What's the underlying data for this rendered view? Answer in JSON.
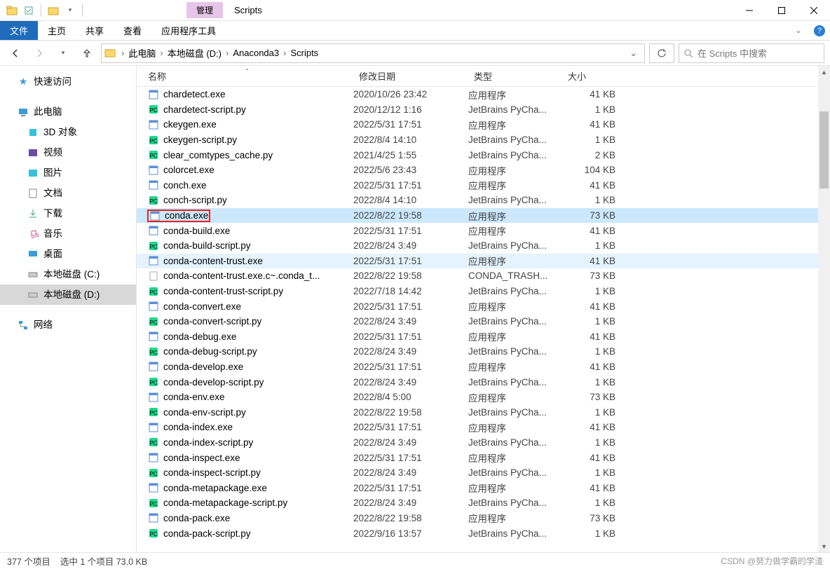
{
  "title": "Scripts",
  "context_tab": "管理",
  "ribbon": {
    "file": "文件",
    "tabs": [
      "主页",
      "共享",
      "查看",
      "应用程序工具"
    ]
  },
  "breadcrumb": [
    "此电脑",
    "本地磁盘 (D:)",
    "Anaconda3",
    "Scripts"
  ],
  "search_placeholder": "在 Scripts 中搜索",
  "nav": {
    "quick": "快速访问",
    "thispc": "此电脑",
    "items": [
      "3D 对象",
      "视频",
      "图片",
      "文档",
      "下载",
      "音乐",
      "桌面",
      "本地磁盘 (C:)",
      "本地磁盘 (D:)"
    ],
    "network": "网络"
  },
  "columns": {
    "name": "名称",
    "date": "修改日期",
    "type": "类型",
    "size": "大小"
  },
  "type_labels": {
    "app": "应用程序",
    "pycharm": "JetBrains PyCha...",
    "trash": "CONDA_TRASH..."
  },
  "files": [
    {
      "n": "chardetect.exe",
      "d": "2020/10/26 23:42",
      "t": "app",
      "s": "41 KB",
      "i": "exe"
    },
    {
      "n": "chardetect-script.py",
      "d": "2020/12/12 1:16",
      "t": "pycharm",
      "s": "1 KB",
      "i": "py"
    },
    {
      "n": "ckeygen.exe",
      "d": "2022/5/31 17:51",
      "t": "app",
      "s": "41 KB",
      "i": "exe"
    },
    {
      "n": "ckeygen-script.py",
      "d": "2022/8/4 14:10",
      "t": "pycharm",
      "s": "1 KB",
      "i": "py"
    },
    {
      "n": "clear_comtypes_cache.py",
      "d": "2021/4/25 1:55",
      "t": "pycharm",
      "s": "2 KB",
      "i": "py"
    },
    {
      "n": "colorcet.exe",
      "d": "2022/5/6 23:43",
      "t": "app",
      "s": "104 KB",
      "i": "exe"
    },
    {
      "n": "conch.exe",
      "d": "2022/5/31 17:51",
      "t": "app",
      "s": "41 KB",
      "i": "exe"
    },
    {
      "n": "conch-script.py",
      "d": "2022/8/4 14:10",
      "t": "pycharm",
      "s": "1 KB",
      "i": "py"
    },
    {
      "n": "conda.exe",
      "d": "2022/8/22 19:58",
      "t": "app",
      "s": "73 KB",
      "i": "exe",
      "selected": true,
      "redbox": true
    },
    {
      "n": "conda-build.exe",
      "d": "2022/5/31 17:51",
      "t": "app",
      "s": "41 KB",
      "i": "exe"
    },
    {
      "n": "conda-build-script.py",
      "d": "2022/8/24 3:49",
      "t": "pycharm",
      "s": "1 KB",
      "i": "py"
    },
    {
      "n": "conda-content-trust.exe",
      "d": "2022/5/31 17:51",
      "t": "app",
      "s": "41 KB",
      "i": "exe",
      "hover": true
    },
    {
      "n": "conda-content-trust.exe.c~.conda_t...",
      "d": "2022/8/22 19:58",
      "t": "trash",
      "s": "73 KB",
      "i": "file"
    },
    {
      "n": "conda-content-trust-script.py",
      "d": "2022/7/18 14:42",
      "t": "pycharm",
      "s": "1 KB",
      "i": "py"
    },
    {
      "n": "conda-convert.exe",
      "d": "2022/5/31 17:51",
      "t": "app",
      "s": "41 KB",
      "i": "exe"
    },
    {
      "n": "conda-convert-script.py",
      "d": "2022/8/24 3:49",
      "t": "pycharm",
      "s": "1 KB",
      "i": "py"
    },
    {
      "n": "conda-debug.exe",
      "d": "2022/5/31 17:51",
      "t": "app",
      "s": "41 KB",
      "i": "exe"
    },
    {
      "n": "conda-debug-script.py",
      "d": "2022/8/24 3:49",
      "t": "pycharm",
      "s": "1 KB",
      "i": "py"
    },
    {
      "n": "conda-develop.exe",
      "d": "2022/5/31 17:51",
      "t": "app",
      "s": "41 KB",
      "i": "exe"
    },
    {
      "n": "conda-develop-script.py",
      "d": "2022/8/24 3:49",
      "t": "pycharm",
      "s": "1 KB",
      "i": "py"
    },
    {
      "n": "conda-env.exe",
      "d": "2022/8/4 5:00",
      "t": "app",
      "s": "73 KB",
      "i": "exe"
    },
    {
      "n": "conda-env-script.py",
      "d": "2022/8/22 19:58",
      "t": "pycharm",
      "s": "1 KB",
      "i": "py"
    },
    {
      "n": "conda-index.exe",
      "d": "2022/5/31 17:51",
      "t": "app",
      "s": "41 KB",
      "i": "exe"
    },
    {
      "n": "conda-index-script.py",
      "d": "2022/8/24 3:49",
      "t": "pycharm",
      "s": "1 KB",
      "i": "py"
    },
    {
      "n": "conda-inspect.exe",
      "d": "2022/5/31 17:51",
      "t": "app",
      "s": "41 KB",
      "i": "exe"
    },
    {
      "n": "conda-inspect-script.py",
      "d": "2022/8/24 3:49",
      "t": "pycharm",
      "s": "1 KB",
      "i": "py"
    },
    {
      "n": "conda-metapackage.exe",
      "d": "2022/5/31 17:51",
      "t": "app",
      "s": "41 KB",
      "i": "exe"
    },
    {
      "n": "conda-metapackage-script.py",
      "d": "2022/8/24 3:49",
      "t": "pycharm",
      "s": "1 KB",
      "i": "py"
    },
    {
      "n": "conda-pack.exe",
      "d": "2022/8/22 19:58",
      "t": "app",
      "s": "73 KB",
      "i": "exe"
    },
    {
      "n": "conda-pack-script.py",
      "d": "2022/9/16 13:57",
      "t": "pycharm",
      "s": "1 KB",
      "i": "py"
    }
  ],
  "status": {
    "count": "377 个项目",
    "sel": "选中 1 个项目 73.0 KB",
    "watermark": "CSDN @努力做学霸的学渣"
  }
}
